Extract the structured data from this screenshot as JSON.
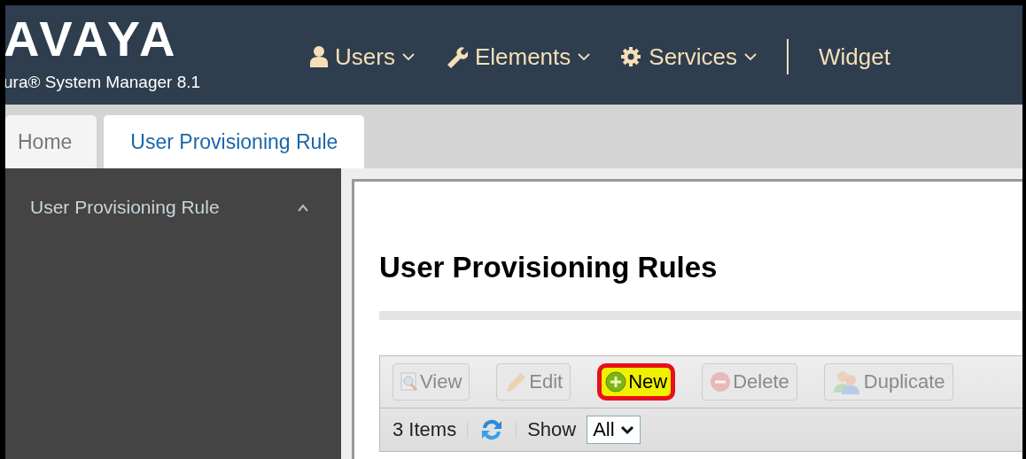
{
  "header": {
    "logo": "AVAYA",
    "subtitle": "ura® System Manager 8.1",
    "nav": [
      {
        "label": "Users",
        "kind": "user",
        "dropdown": true
      },
      {
        "label": "Elements",
        "kind": "wrench",
        "dropdown": true
      },
      {
        "label": "Services",
        "kind": "gear",
        "dropdown": true
      },
      {
        "label": "Widget",
        "kind": "plain",
        "dropdown": false
      }
    ]
  },
  "tabs": [
    {
      "label": "Home",
      "selected": false
    },
    {
      "label": "User Provisioning Rule",
      "selected": true
    }
  ],
  "sidebar": {
    "items": [
      {
        "label": "User Provisioning Rule",
        "expanded": true
      }
    ]
  },
  "content": {
    "title": "User Provisioning Rules",
    "toolbar": [
      {
        "label": "View",
        "kind": "view",
        "disabled": true,
        "highlighted": false
      },
      {
        "label": "Edit",
        "kind": "edit",
        "disabled": true,
        "highlighted": false
      },
      {
        "label": "New",
        "kind": "new",
        "disabled": false,
        "highlighted": true
      },
      {
        "label": "Delete",
        "kind": "delete",
        "disabled": true,
        "highlighted": false
      },
      {
        "label": "Duplicate",
        "kind": "duplicate",
        "disabled": true,
        "highlighted": false
      }
    ],
    "count": "3 Items",
    "show_label": "Show",
    "show_value": "All"
  }
}
